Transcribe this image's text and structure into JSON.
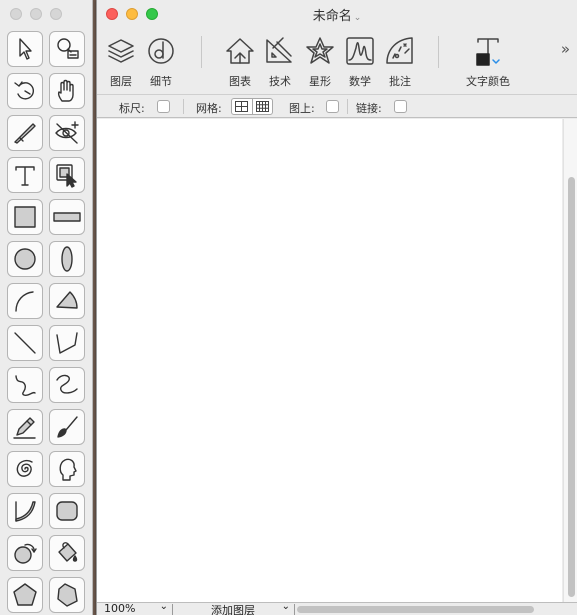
{
  "palette": {
    "tools": [
      {
        "icon": "arrow-pointer-icon"
      },
      {
        "icon": "zoom-magnifier-icon"
      },
      {
        "icon": "rotate-icon"
      },
      {
        "icon": "hand-pan-icon"
      },
      {
        "icon": "knife-cut-icon"
      },
      {
        "icon": "hide-eye-icon"
      },
      {
        "icon": "text-tool-icon"
      },
      {
        "icon": "image-select-icon"
      },
      {
        "icon": "rectangle-icon"
      },
      {
        "icon": "rounded-bar-icon"
      },
      {
        "icon": "circle-icon"
      },
      {
        "icon": "ellipse-icon"
      },
      {
        "icon": "arc-icon"
      },
      {
        "icon": "pie-wedge-icon"
      },
      {
        "icon": "line-icon"
      },
      {
        "icon": "polyline-icon"
      },
      {
        "icon": "freehand-curve-icon"
      },
      {
        "icon": "squiggle-icon"
      },
      {
        "icon": "pencil-icon"
      },
      {
        "icon": "paintbrush-icon"
      },
      {
        "icon": "spiral-icon"
      },
      {
        "icon": "head-profile-icon"
      },
      {
        "icon": "quarter-shape-icon"
      },
      {
        "icon": "rounded-rect-icon"
      },
      {
        "icon": "shape-rotate-icon"
      },
      {
        "icon": "paint-bucket-icon"
      },
      {
        "icon": "pentagon-icon"
      },
      {
        "icon": "polygon-icon"
      }
    ]
  },
  "window": {
    "title": "未命名",
    "title_chevron": "⌄"
  },
  "toolbar": {
    "items": [
      {
        "label": "图层",
        "icon": "layers-icon"
      },
      {
        "label": "细节",
        "icon": "details-icon"
      },
      {
        "label": "图表",
        "icon": "chart-house-icon"
      },
      {
        "label": "技术",
        "icon": "technical-ruler-icon"
      },
      {
        "label": "星形",
        "icon": "star-icon"
      },
      {
        "label": "数学",
        "icon": "math-graph-icon"
      },
      {
        "label": "批注",
        "icon": "annotation-icon"
      },
      {
        "label": "文字颜色",
        "icon": "text-color-icon"
      }
    ],
    "overflow": "»",
    "accent": "#2a8ee8"
  },
  "options": {
    "ruler_label": "标尺:",
    "grid_label": "网格:",
    "on_top_label": "图上:",
    "link_label": "链接:"
  },
  "bottom": {
    "zoom": "100%",
    "zoom_arrow": "⌄",
    "add_layer": "添加图层",
    "add_layer_arrow": "⌄"
  },
  "colors": {
    "close": "#fc605c",
    "minimize": "#fdbc40",
    "maximize": "#34c84a"
  }
}
